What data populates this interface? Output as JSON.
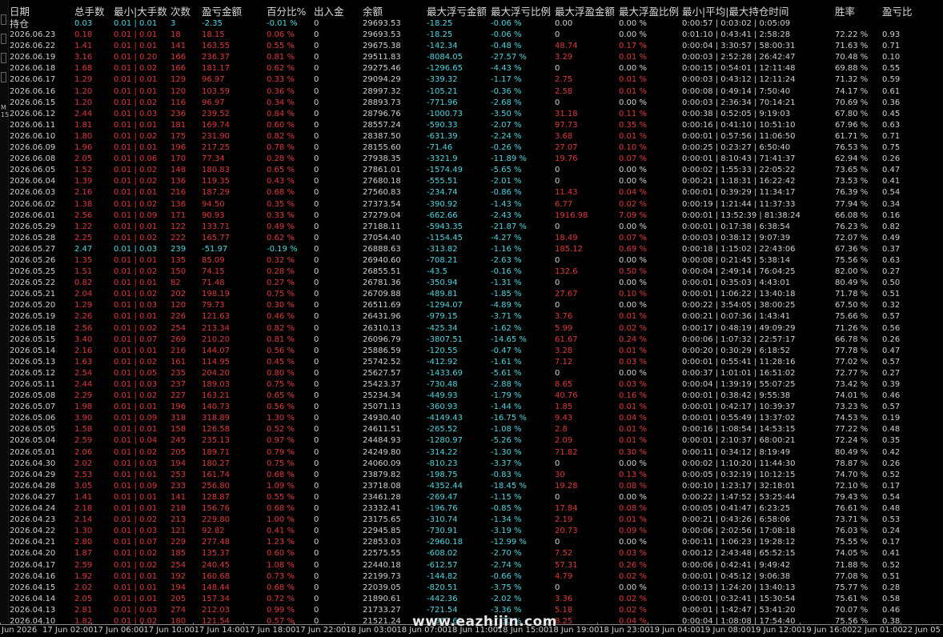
{
  "headers": [
    "日期",
    "总手数",
    "最小|大手数",
    "次数",
    "盈亏金额",
    "百分比%",
    "出入金",
    "余额",
    "最大浮亏金额",
    "最大浮亏比例",
    "最大浮盈金额",
    "最大浮盈比例",
    "最小|平均|最大持仓时间",
    "胜率",
    "盈亏比"
  ],
  "position_row": {
    "label": "持仓",
    "lots": "0.03",
    "minmax": "0.01 | 0.01",
    "count": "3",
    "pnl": "-2.35",
    "pct": "-0.01 %",
    "flow": "0",
    "balance": "29693.53",
    "maxloss": "-18.25",
    "maxloss_pct": "-0.06 %",
    "maxgain": "0.00",
    "maxgain_pct": "0.00 %",
    "hold": "0:00:57 | 0:03:02 | 0:05:09",
    "winrate": "",
    "ratio": ""
  },
  "rows": [
    [
      "2026.06.23",
      "0.18",
      "0.01 | 0.01",
      "18",
      "18.15",
      "0.06 %",
      "0",
      "29693.53",
      "-18.25",
      "-0.06 %",
      "0",
      "0.00 %",
      "0:01:10 | 0:43:41 | 2:58:28",
      "72.22 %",
      "0.93"
    ],
    [
      "2026.06.22",
      "1.41",
      "0.01 | 0.01",
      "141",
      "163.55",
      "0.55 %",
      "0",
      "29675.38",
      "-142.34",
      "-0.48 %",
      "48.74",
      "0.17 %",
      "0:00:04 | 3:30:57 | 58:00:31",
      "71.63 %",
      "0.71"
    ],
    [
      "2026.06.19",
      "3.16",
      "0.01 | 0.20",
      "166",
      "236.37",
      "0.81 %",
      "0",
      "29511.83",
      "-8084.05",
      "-27.57 %",
      "3.29",
      "0.01 %",
      "0:00:03 | 2:52:28 | 26:42:47",
      "70.48 %",
      "0.10"
    ],
    [
      "2026.06.18",
      "1.68",
      "0.01 | 0.02",
      "166",
      "181.17",
      "0.62 %",
      "0",
      "29275.46",
      "-1296.65",
      "-4.43 %",
      "0",
      "0.00 %",
      "0:00:15 | 0:54:01 | 12:11:48",
      "69.88 %",
      "0.55"
    ],
    [
      "2026.06.17",
      "1.29",
      "0.01 | 0.01",
      "129",
      "96.97",
      "0.33 %",
      "0",
      "29094.29",
      "-339.32",
      "-1.17 %",
      "2.75",
      "0.01 %",
      "0:00:03 | 0:43:12 | 12:11:24",
      "71.32 %",
      "0.59"
    ],
    [
      "2026.06.16",
      "1.20",
      "0.01 | 0.01",
      "120",
      "103.59",
      "0.36 %",
      "0",
      "28997.32",
      "-105.21",
      "-0.36 %",
      "2.58",
      "0.01 %",
      "0:00:08 | 0:49:14 | 7:50:40",
      "74.17 %",
      "0.61"
    ],
    [
      "2026.06.15",
      "1.20",
      "0.01 | 0.02",
      "116",
      "96.97",
      "0.34 %",
      "0",
      "28893.73",
      "-771.96",
      "-2.68 %",
      "0",
      "0.00 %",
      "0:00:03 | 2:36:34 | 70:14:21",
      "70.69 %",
      "0.36"
    ],
    [
      "2026.06.12",
      "2.44",
      "0.01 | 0.03",
      "236",
      "239.52",
      "0.84 %",
      "0",
      "28796.76",
      "-1000.73",
      "-3.50 %",
      "31.18",
      "0.11 %",
      "0:00:38 | 0:52:05 | 9:19:03",
      "67.80 %",
      "0.45"
    ],
    [
      "2026.06.11",
      "1.81",
      "0.01 | 0.01",
      "181",
      "169.74",
      "0.60 %",
      "0",
      "28557.24",
      "-590.33",
      "-2.07 %",
      "97.73",
      "0.35 %",
      "0:00:16 | 0:41:10 | 10:51:10",
      "67.96 %",
      "0.63"
    ],
    [
      "2026.06.10",
      "1.80",
      "0.01 | 0.02",
      "175",
      "231.90",
      "0.82 %",
      "0",
      "28387.50",
      "-631.39",
      "-2.24 %",
      "3.68",
      "0.01 %",
      "0:00:01 | 0:57:56 | 11:06:50",
      "61.71 %",
      "0.71"
    ],
    [
      "2026.06.09",
      "1.96",
      "0.01 | 0.01",
      "196",
      "217.25",
      "0.78 %",
      "0",
      "28155.60",
      "-71.46",
      "-0.26 %",
      "27.07",
      "0.10 %",
      "0:00:25 | 0:23:27 | 6:50:40",
      "76.53 %",
      "0.75"
    ],
    [
      "2026.06.08",
      "2.05",
      "0.01 | 0.06",
      "170",
      "77.34",
      "0.28 %",
      "0",
      "27938.35",
      "-3321.9",
      "-11.89 %",
      "19.76",
      "0.07 %",
      "0:00:01 | 8:10:43 | 71:41:37",
      "62.94 %",
      "0.26"
    ],
    [
      "2026.06.05",
      "1.52",
      "0.01 | 0.02",
      "148",
      "180.83",
      "0.65 %",
      "0",
      "27861.01",
      "-1574.49",
      "-5.65 %",
      "0",
      "0.00 %",
      "0:00:02 | 1:55:33 | 22:05:22",
      "73.65 %",
      "0.47"
    ],
    [
      "2026.06.04",
      "1.39",
      "0.01 | 0.02",
      "136",
      "119.35",
      "0.43 %",
      "0",
      "27680.18",
      "-555.51",
      "-2.01 %",
      "0",
      "0.00 %",
      "0:00:21 | 1:18:31 | 16:22:42",
      "73.53 %",
      "0.41"
    ],
    [
      "2026.06.03",
      "2.16",
      "0.01 | 0.01",
      "216",
      "187.29",
      "0.68 %",
      "0",
      "27560.83",
      "-234.74",
      "-0.86 %",
      "11.43",
      "0.04 %",
      "0:00:01 | 0:39:29 | 11:34:17",
      "76.39 %",
      "0.54"
    ],
    [
      "2026.06.02",
      "1.38",
      "0.01 | 0.02",
      "136",
      "94.50",
      "0.35 %",
      "0",
      "27373.54",
      "-390.92",
      "-1.43 %",
      "6.77",
      "0.02 %",
      "0:00:19 | 1:21:44 | 11:37:33",
      "77.94 %",
      "0.34"
    ],
    [
      "2026.06.01",
      "2.56",
      "0.01 | 0.09",
      "171",
      "90.93",
      "0.33 %",
      "0",
      "27279.04",
      "-662.66",
      "-2.43 %",
      "1916.98",
      "7.09 %",
      "0:00:01 | 13:52:39 | 81:38:24",
      "66.08 %",
      "0.16"
    ],
    [
      "2026.05.29",
      "1.22",
      "0.01 | 0.01",
      "122",
      "133.71",
      "0.49 %",
      "0",
      "27188.11",
      "-5943.35",
      "-21.87 %",
      "0",
      "0.00 %",
      "0:00:01 | 0:17:38 | 6:38:54",
      "76.23 %",
      "0.82"
    ],
    [
      "2026.05.28",
      "2.25",
      "0.01 | 0.02",
      "222",
      "165.77",
      "0.62 %",
      "0",
      "27054.40",
      "-1154.45",
      "-4.27 %",
      "18.49",
      "0.07 %",
      "0:00:03 | 0:38:12 | 9:07:39",
      "72.07 %",
      "0.49"
    ],
    [
      "2026.05.27",
      "2.47",
      "0.01 | 0.03",
      "239",
      "-51.97",
      "-0.19 %",
      "0",
      "26888.63",
      "-313.82",
      "-1.16 %",
      "185.12",
      "0.69 %",
      "0:00:18 | 1:15:02 | 22:43:06",
      "67.36 %",
      "0.37"
    ],
    [
      "2026.05.26",
      "1.35",
      "0.01 | 0.01",
      "135",
      "85.09",
      "0.32 %",
      "0",
      "26940.60",
      "-708.21",
      "-2.63 %",
      "0",
      "0.00 %",
      "0:00:08 | 0:21:45 | 5:38:14",
      "75.56 %",
      "0.63"
    ],
    [
      "2026.05.25",
      "1.51",
      "0.01 | 0.02",
      "150",
      "74.15",
      "0.28 %",
      "0",
      "26855.51",
      "-43.5",
      "-0.16 %",
      "132.6",
      "0.50 %",
      "0:00:04 | 2:49:14 | 76:04:25",
      "82.00 %",
      "0.27"
    ],
    [
      "2026.05.22",
      "0.82",
      "0.01 | 0.01",
      "82",
      "71.48",
      "0.27 %",
      "0",
      "26781.36",
      "-350.94",
      "-1.31 %",
      "0",
      "0.00 %",
      "0:00:01 | 0:35:03 | 4:43:01",
      "80.49 %",
      "0.50"
    ],
    [
      "2026.05.21",
      "2.04",
      "0.01 | 0.02",
      "202",
      "198.19",
      "0.75 %",
      "0",
      "26709.88",
      "-489.81",
      "-1.85 %",
      "27.67",
      "0.10 %",
      "0:00:01 | 1:06:22 | 13:40:18",
      "71.78 %",
      "0.51"
    ],
    [
      "2026.05.20",
      "1.29",
      "0.01 | 0.03",
      "120",
      "79.73",
      "0.30 %",
      "0",
      "26511.69",
      "-1294.07",
      "-4.89 %",
      "0",
      "0.00 %",
      "0:00:22 | 3:54:05 | 38:00:25",
      "67.50 %",
      "0.32"
    ],
    [
      "2026.05.19",
      "2.26",
      "0.01 | 0.01",
      "226",
      "121.63",
      "0.46 %",
      "0",
      "26431.96",
      "-979.15",
      "-3.71 %",
      "3.76",
      "0.01 %",
      "0:00:21 | 0:07:36 | 1:43:41",
      "75.66 %",
      "0.57"
    ],
    [
      "2026.05.18",
      "2.56",
      "0.01 | 0.02",
      "254",
      "213.34",
      "0.82 %",
      "0",
      "26310.13",
      "-425.34",
      "-1.62 %",
      "5.99",
      "0.02 %",
      "0:00:17 | 0:48:19 | 49:09:29",
      "71.26 %",
      "0.56"
    ],
    [
      "2026.05.15",
      "3.40",
      "0.01 | 0.07",
      "269",
      "210.20",
      "0.81 %",
      "0",
      "26096.79",
      "-3807.51",
      "-14.65 %",
      "61.67",
      "0.24 %",
      "0:00:06 | 1:07:32 | 22:57:17",
      "66.78 %",
      "0.26"
    ],
    [
      "2026.05.14",
      "2.16",
      "0.01 | 0.01",
      "216",
      "144.07",
      "0.56 %",
      "0",
      "25886.59",
      "-120.55",
      "-0.47 %",
      "3.28",
      "0.01 %",
      "0:00:20 | 0:30:29 | 6:18:52",
      "77.78 %",
      "0.47"
    ],
    [
      "2026.05.13",
      "1.63",
      "0.01 | 0.02",
      "161",
      "114.95",
      "0.45 %",
      "0",
      "25742.52",
      "-412.92",
      "-1.61 %",
      "7.12",
      "0.03 %",
      "0:00:01 | 0:55:41 | 11:28:16",
      "77.02 %",
      "0.57"
    ],
    [
      "2026.05.12",
      "2.54",
      "0.01 | 0.05",
      "235",
      "204.20",
      "0.80 %",
      "0",
      "25627.57",
      "-1433.69",
      "-5.61 %",
      "0",
      "0.00 %",
      "0:00:37 | 1:01:01 | 16:51:02",
      "72.77 %",
      "0.27"
    ],
    [
      "2026.05.11",
      "2.44",
      "0.01 | 0.03",
      "237",
      "189.03",
      "0.75 %",
      "0",
      "25423.37",
      "-730.48",
      "-2.88 %",
      "8.65",
      "0.03 %",
      "0:00:04 | 1:39:19 | 55:07:25",
      "73.42 %",
      "0.39"
    ],
    [
      "2026.05.08",
      "2.29",
      "0.01 | 0.02",
      "227",
      "163.21",
      "0.65 %",
      "0",
      "25234.34",
      "-449.93",
      "-1.79 %",
      "40.76",
      "0.16 %",
      "0:00:01 | 0:38:42 | 9:55:38",
      "74.01 %",
      "0.46"
    ],
    [
      "2026.05.07",
      "1.98",
      "0.01 | 0.01",
      "196",
      "140.73",
      "0.56 %",
      "0",
      "25071.13",
      "-360.93",
      "-1.44 %",
      "1.85",
      "0.01 %",
      "0:00:01 | 0:42:17 | 10:39:37",
      "73.23 %",
      "0.57"
    ],
    [
      "2026.05.06",
      "3.90",
      "0.01 | 0.09",
      "318",
      "318.89",
      "1.30 %",
      "0",
      "24930.40",
      "-4149.43",
      "-16.75 %",
      "9.43",
      "0.04 %",
      "0:00:01 | 0:55:49 | 13:37:02",
      "74.53 %",
      "0.19"
    ],
    [
      "2026.05.05",
      "1.58",
      "0.01 | 0.01",
      "158",
      "126.58",
      "0.52 %",
      "0",
      "24611.51",
      "-265.52",
      "-1.08 %",
      "2.8",
      "0.01 %",
      "0:00:16 | 1:08:54 | 14:53:15",
      "77.22 %",
      "0.48"
    ],
    [
      "2026.05.04",
      "2.59",
      "0.01 | 0.04",
      "245",
      "235.13",
      "0.97 %",
      "0",
      "24484.93",
      "-1280.97",
      "-5.26 %",
      "2.09",
      "0.01 %",
      "0:00:01 | 2:10:37 | 68:00:21",
      "72.24 %",
      "0.35"
    ],
    [
      "2026.05.01",
      "2.06",
      "0.01 | 0.02",
      "205",
      "189.71",
      "0.79 %",
      "0",
      "24249.80",
      "-314.22",
      "-1.30 %",
      "71.82",
      "0.30 %",
      "0:00:11 | 0:34:12 | 8:19:49",
      "80.49 %",
      "0.42"
    ],
    [
      "2026.04.30",
      "2.02",
      "0.01 | 0.03",
      "194",
      "180.27",
      "0.75 %",
      "0",
      "24060.09",
      "-810.23",
      "-3.37 %",
      "0",
      "0.00 %",
      "0:00:02 | 1:10:20 | 11:44:30",
      "78.87 %",
      "0.26"
    ],
    [
      "2026.04.29",
      "2.53",
      "0.01 | 0.01",
      "253",
      "161.74",
      "0.68 %",
      "0",
      "23879.82",
      "-198.75",
      "-0.83 %",
      "30",
      "0.13 %",
      "0:00:05 | 0:32:19 | 10:12:15",
      "74.70 %",
      "0.52"
    ],
    [
      "2026.04.28",
      "3.05",
      "0.01 | 0.09",
      "233",
      "256.80",
      "1.09 %",
      "0",
      "23718.08",
      "-4352.44",
      "-18.45 %",
      "19.28",
      "0.08 %",
      "0:00:10 | 1:23:17 | 32:18:01",
      "72.10 %",
      "0.17"
    ],
    [
      "2026.04.27",
      "1.41",
      "0.01 | 0.01",
      "141",
      "128.87",
      "0.55 %",
      "0",
      "23461.28",
      "-269.47",
      "-1.15 %",
      "0",
      "0.00 %",
      "0:00:22 | 1:47:52 | 53:25:44",
      "79.43 %",
      "0.54"
    ],
    [
      "2026.04.24",
      "2.18",
      "0.01 | 0.01",
      "218",
      "156.76",
      "0.68 %",
      "0",
      "23332.41",
      "-196.76",
      "-0.85 %",
      "17.84",
      "0.08 %",
      "0:00:05 | 0:41:47 | 6:23:25",
      "76.61 %",
      "0.48"
    ],
    [
      "2026.04.23",
      "2.14",
      "0.01 | 0.02",
      "213",
      "229.80",
      "1.00 %",
      "0",
      "23175.65",
      "-310.74",
      "-1.34 %",
      "2.19",
      "0.01 %",
      "0:00:21 | 0:43:26 | 6:58:06",
      "73.71 %",
      "0.53"
    ],
    [
      "2026.04.22",
      "1.30",
      "0.01 | 0.03",
      "121",
      "92.82",
      "0.41 %",
      "0",
      "22945.85",
      "-730.91",
      "-3.19 %",
      "20.73",
      "0.09 %",
      "0:00:06 | 2:02:56 | 17:08:18",
      "76.03 %",
      "0.24"
    ],
    [
      "2026.04.21",
      "2.80",
      "0.01 | 0.07",
      "229",
      "277.48",
      "1.23 %",
      "0",
      "22853.03",
      "-2960.18",
      "-12.99 %",
      "0",
      "0.00 %",
      "0:00:11 | 1:06:23 | 19:28:12",
      "75.55 %",
      "0.17"
    ],
    [
      "2026.04.20",
      "1.87",
      "0.01 | 0.02",
      "185",
      "135.37",
      "0.60 %",
      "0",
      "22575.55",
      "-608.02",
      "-2.70 %",
      "7.52",
      "0.03 %",
      "0:00:12 | 2:43:48 | 65:52:15",
      "74.05 %",
      "0.41"
    ],
    [
      "2026.04.17",
      "2.59",
      "0.01 | 0.02",
      "254",
      "240.45",
      "1.08 %",
      "0",
      "22440.18",
      "-612.57",
      "-2.74 %",
      "57.31",
      "0.26 %",
      "0:00:06 | 0:42:41 | 9:49:42",
      "71.88 %",
      "0.52"
    ],
    [
      "2026.04.16",
      "1.92",
      "0.01 | 0.01",
      "192",
      "160.68",
      "0.73 %",
      "0",
      "22199.73",
      "-144.82",
      "-0.66 %",
      "4.79",
      "0.02 %",
      "0:00:01 | 0:45:12 | 9:06:38",
      "77.08 %",
      "0.51"
    ],
    [
      "2026.04.15",
      "2.02",
      "0.01 | 0.01",
      "194",
      "148.44",
      "0.68 %",
      "0",
      "22039.05",
      "-820.51",
      "-3.75 %",
      "0",
      "0.00 %",
      "0:00:13 | 1:24:20 | 13:40:13",
      "75.77 %",
      "0.28"
    ],
    [
      "2026.04.14",
      "2.05",
      "0.01 | 0.01",
      "205",
      "157.34",
      "0.72 %",
      "0",
      "21890.61",
      "-442.36",
      "-2.02 %",
      "3.36",
      "0.02 %",
      "0:00:01 | 0:32:41 | 15:30:54",
      "75.61 %",
      "0.58"
    ],
    [
      "2026.04.13",
      "2.81",
      "0.01 | 0.03",
      "274",
      "212.03",
      "0.99 %",
      "0",
      "21733.27",
      "-721.54",
      "-3.36 %",
      "5.18",
      "0.02 %",
      "0:00:01 | 1:42:47 | 53:41:20",
      "70.07 %",
      "0.46"
    ],
    [
      "2026.04.10",
      "1.82",
      "0.01 | 0.02",
      "180",
      "121.54",
      "0.57 %",
      "0",
      "21521.24",
      "-1567.62",
      "-7.30 %",
      "8.25",
      "0.04 %",
      "0:00:04 | 1:08:08 | 17:54:40",
      "75.56 %",
      "0.38"
    ]
  ],
  "time_axis": [
    "Jun 2026",
    "17 Jun 02:00",
    "17 Jun 06:00",
    "17 Jun 10:00",
    "17 Jun 14:00",
    "17 Jun 18:00",
    "17 Jun 22:00",
    "18 Jun 03:00",
    "18 Jun 07:00",
    "18 Jun 11:00",
    "18 Jun 15:00",
    "18 Jun 19:00",
    "18 Jun 23:00",
    "19 Jun 04:00",
    "19 Jun 08:00",
    "19 Jun 12:00",
    "19 Jun 16:00",
    "22 Jun 01:00",
    "22 Jun 05"
  ],
  "watermark": "www.eazhijin.com",
  "left_toolbar_text": "M 15",
  "colors": {
    "negative": "#e03a3a",
    "summary": "#4fd7e0",
    "text": "#c8c8c8",
    "background": "#000000"
  }
}
